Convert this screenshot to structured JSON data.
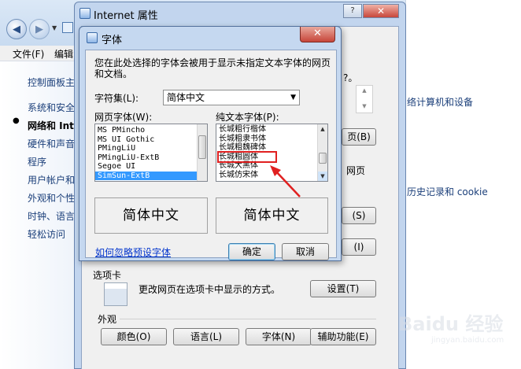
{
  "control_panel": {
    "menu": {
      "file": "文件(F)",
      "edit": "编辑"
    },
    "sidebar_links": [
      "控制面板主",
      "系统和安全",
      "网络和 Inte",
      "硬件和声音",
      "程序",
      "用户帐户和",
      "外观和个性",
      "时钟、语言",
      "轻松访问"
    ],
    "active_index": 2,
    "main_links": [
      "络计算机和设备",
      "历史记录和 cookie"
    ]
  },
  "internet_options": {
    "title": "Internet 属性",
    "fragments": {
      "top_right_text": "?。",
      "home_btn": "页(B)",
      "home_text": "网页",
      "btn_s": "(S)",
      "btn_i": "(I)",
      "tabs_heading": "选项卡"
    },
    "tabs_desc": "更改网页在选项卡中显示的方式。",
    "tabs_settings_button": "设置(T)",
    "appearance_heading": "外观",
    "buttons": {
      "colors": "颜色(O)",
      "languages": "语言(L)",
      "fonts": "字体(N)",
      "accessibility": "辅助功能(E)"
    }
  },
  "fonts_dialog": {
    "title": "字体",
    "description": "您在此处选择的字体会被用于显示未指定文本字体的网页和文档。",
    "charset_label": "字符集(L):",
    "charset_value": "简体中文",
    "web_font_label": "网页字体(W):",
    "plain_font_label": "纯文本字体(P):",
    "web_fonts": [
      "MS PMincho",
      "MS UI Gothic",
      "PMingLiU",
      "PMingLiU-ExtB",
      "Segoe UI",
      "SimSun-ExtB"
    ],
    "web_font_selected": 5,
    "plain_fonts": [
      "长城粗行楷体",
      "长城粗隶书体",
      "长城粗魏碑体",
      "长城粗圆体",
      "长城大黑体",
      "长城仿宋体"
    ],
    "plain_font_highlighted": 3,
    "preview_web": "简体中文",
    "preview_plain": "简体中文",
    "ignore_link": "如何忽略预设字体",
    "ok_button": "确定",
    "cancel_button": "取消"
  },
  "annotation": {
    "highlight_color": "#e02020",
    "arrow_color": "#e02020"
  },
  "watermark": {
    "text": "Baidu 经验",
    "subtext": "jingyan.baidu.com"
  }
}
